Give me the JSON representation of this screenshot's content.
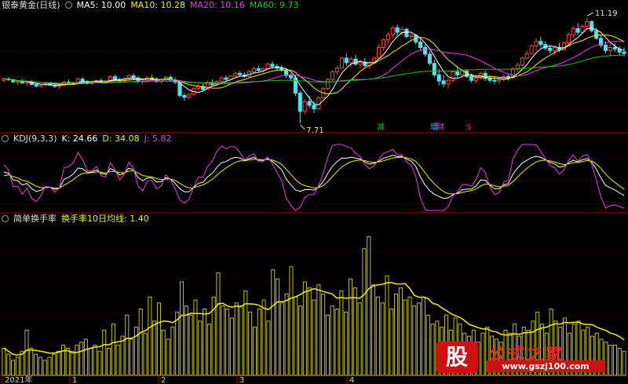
{
  "colors": {
    "up": "#ff4040",
    "down": "#50e0f0",
    "ma5": "#ffffff",
    "ma10": "#f0f000",
    "ma20": "#e040e0",
    "ma60": "#20c020",
    "k": "#ffffff",
    "d": "#f0f000",
    "j": "#e040e0",
    "bar": "#f0f000",
    "avg": "#f0f000",
    "divider": "#a00000"
  },
  "main": {
    "title": "银泰黄金(日线)",
    "ma": [
      {
        "label": "MA5: 10.00",
        "color": "#ffffff"
      },
      {
        "label": "MA10: 10.28",
        "color": "#f0f000"
      },
      {
        "label": "MA20: 10.16",
        "color": "#e040e0"
      },
      {
        "label": "MA60: 9.73",
        "color": "#20c020"
      }
    ],
    "high_label": "11.19",
    "low_label": "7.71",
    "markers": [
      {
        "text": "减",
        "color": "#20c020"
      },
      {
        "text": "增",
        "color": "#20c0ff"
      },
      {
        "text": "财",
        "color": "#e040e0"
      },
      {
        "text": "S",
        "color": "#ff3030"
      }
    ]
  },
  "kdj": {
    "title": "KDJ(9,3,3)",
    "k_label": "K: 24.66",
    "d_label": "D: 34.08",
    "j_label": "J: 5.82"
  },
  "turnover": {
    "title": "简单换手率",
    "avg_label": "换手率10日均线: 1.40"
  },
  "xaxis": {
    "ticks": [
      "2021年",
      "1",
      "2",
      "3",
      "4"
    ]
  },
  "watermark": {
    "box_text": "股",
    "title": "公式之家",
    "url": "www.gszj100.com"
  },
  "chart_data": [
    {
      "type": "candlestick",
      "title": "银泰黄金(日线)",
      "high": 11.19,
      "low": 7.71,
      "ylim": [
        7.5,
        11.4
      ],
      "candles": [
        [
          9.12,
          9.2,
          9.05,
          9.17
        ],
        [
          9.17,
          9.22,
          9.1,
          9.14
        ],
        [
          9.14,
          9.18,
          9.03,
          9.07
        ],
        [
          9.07,
          9.12,
          8.98,
          9.08
        ],
        [
          9.08,
          9.15,
          9.02,
          9.03
        ],
        [
          9.03,
          9.1,
          8.95,
          9.07
        ],
        [
          9.07,
          9.12,
          8.96,
          8.98
        ],
        [
          8.98,
          9.02,
          8.88,
          8.93
        ],
        [
          8.93,
          9.0,
          8.86,
          8.97
        ],
        [
          8.97,
          9.05,
          8.92,
          9.02
        ],
        [
          9.02,
          9.08,
          8.95,
          8.96
        ],
        [
          8.96,
          9.0,
          8.87,
          8.92
        ],
        [
          8.92,
          8.99,
          8.84,
          8.95
        ],
        [
          8.95,
          9.1,
          8.93,
          9.06
        ],
        [
          9.06,
          9.15,
          9.0,
          9.02
        ],
        [
          9.02,
          9.08,
          8.97,
          9.05
        ],
        [
          9.05,
          9.2,
          9.03,
          9.16
        ],
        [
          9.16,
          9.22,
          9.05,
          9.08
        ],
        [
          9.08,
          9.12,
          8.98,
          9.02
        ],
        [
          9.02,
          9.1,
          8.97,
          9.07
        ],
        [
          9.07,
          9.15,
          9.02,
          9.11
        ],
        [
          9.11,
          9.18,
          9.04,
          9.06
        ],
        [
          9.06,
          9.14,
          9.0,
          9.1
        ],
        [
          9.1,
          9.28,
          9.08,
          9.24
        ],
        [
          9.24,
          9.3,
          9.12,
          9.15
        ],
        [
          9.15,
          9.2,
          9.05,
          9.1
        ],
        [
          9.1,
          9.22,
          9.08,
          9.18
        ],
        [
          9.18,
          9.32,
          9.14,
          9.27
        ],
        [
          9.27,
          9.35,
          9.15,
          9.2
        ],
        [
          9.2,
          9.25,
          9.02,
          9.08
        ],
        [
          9.08,
          9.14,
          8.98,
          9.1
        ],
        [
          9.1,
          9.25,
          9.05,
          9.2
        ],
        [
          9.2,
          9.3,
          9.12,
          9.16
        ],
        [
          9.16,
          9.22,
          9.04,
          9.08
        ],
        [
          9.08,
          9.18,
          9.02,
          9.14
        ],
        [
          9.14,
          9.26,
          9.1,
          9.22
        ],
        [
          9.22,
          9.3,
          9.1,
          9.13
        ],
        [
          9.13,
          9.2,
          9.0,
          9.06
        ],
        [
          9.06,
          9.12,
          8.55,
          8.62
        ],
        [
          8.62,
          8.7,
          8.45,
          8.56
        ],
        [
          8.56,
          8.7,
          8.5,
          8.66
        ],
        [
          8.66,
          8.9,
          8.62,
          8.85
        ],
        [
          8.85,
          9.0,
          8.8,
          8.92
        ],
        [
          8.92,
          9.0,
          8.75,
          8.82
        ],
        [
          8.82,
          9.1,
          8.8,
          9.05
        ],
        [
          9.05,
          9.15,
          8.92,
          8.98
        ],
        [
          8.98,
          9.12,
          8.94,
          9.08
        ],
        [
          9.08,
          9.25,
          9.05,
          9.2
        ],
        [
          9.2,
          9.28,
          9.1,
          9.15
        ],
        [
          9.15,
          9.3,
          9.12,
          9.26
        ],
        [
          9.26,
          9.4,
          9.22,
          9.35
        ],
        [
          9.35,
          9.42,
          9.25,
          9.3
        ],
        [
          9.3,
          9.38,
          9.2,
          9.25
        ],
        [
          9.25,
          9.45,
          9.22,
          9.4
        ],
        [
          9.4,
          9.55,
          9.35,
          9.5
        ],
        [
          9.5,
          9.6,
          9.4,
          9.44
        ],
        [
          9.44,
          9.55,
          9.38,
          9.5
        ],
        [
          9.5,
          9.7,
          9.45,
          9.65
        ],
        [
          9.65,
          9.75,
          9.5,
          9.58
        ],
        [
          9.58,
          9.65,
          9.45,
          9.52
        ],
        [
          9.52,
          9.62,
          9.4,
          9.46
        ],
        [
          9.46,
          9.52,
          9.2,
          9.28
        ],
        [
          9.28,
          9.35,
          9.1,
          9.2
        ],
        [
          9.2,
          9.3,
          8.6,
          8.7
        ],
        [
          8.7,
          8.78,
          7.71,
          8.1
        ],
        [
          8.1,
          8.5,
          8.0,
          8.42
        ],
        [
          8.42,
          8.6,
          8.2,
          8.3
        ],
        [
          8.3,
          8.45,
          8.05,
          8.18
        ],
        [
          8.18,
          8.6,
          8.15,
          8.55
        ],
        [
          8.55,
          8.9,
          8.5,
          8.85
        ],
        [
          8.85,
          9.2,
          8.8,
          9.15
        ],
        [
          9.15,
          9.45,
          9.1,
          9.4
        ],
        [
          9.4,
          9.6,
          9.3,
          9.52
        ],
        [
          9.52,
          9.9,
          9.5,
          9.85
        ],
        [
          9.85,
          10.0,
          9.6,
          9.7
        ],
        [
          9.7,
          9.9,
          9.55,
          9.82
        ],
        [
          9.82,
          9.95,
          9.6,
          9.65
        ],
        [
          9.65,
          9.8,
          9.5,
          9.72
        ],
        [
          9.72,
          9.85,
          9.55,
          9.6
        ],
        [
          9.6,
          9.75,
          9.5,
          9.7
        ],
        [
          9.7,
          9.9,
          9.65,
          9.85
        ],
        [
          9.85,
          10.3,
          9.8,
          10.2
        ],
        [
          10.2,
          10.5,
          10.1,
          10.45
        ],
        [
          10.45,
          10.7,
          10.3,
          10.62
        ],
        [
          10.62,
          10.9,
          10.5,
          10.85
        ],
        [
          10.85,
          10.95,
          10.6,
          10.7
        ],
        [
          10.7,
          10.9,
          10.6,
          10.8
        ],
        [
          10.8,
          10.85,
          10.5,
          10.56
        ],
        [
          10.56,
          10.7,
          10.4,
          10.6
        ],
        [
          10.6,
          10.65,
          10.3,
          10.38
        ],
        [
          10.38,
          10.5,
          10.1,
          10.2
        ],
        [
          10.2,
          10.3,
          9.9,
          9.98
        ],
        [
          9.98,
          10.1,
          9.6,
          9.68
        ],
        [
          9.68,
          9.8,
          9.2,
          9.3
        ],
        [
          9.3,
          9.5,
          8.95,
          9.1
        ],
        [
          9.1,
          9.3,
          8.9,
          9.0
        ],
        [
          9.0,
          9.2,
          8.85,
          9.12
        ],
        [
          9.12,
          9.45,
          9.05,
          9.4
        ],
        [
          9.4,
          9.6,
          9.2,
          9.3
        ],
        [
          9.3,
          9.5,
          9.18,
          9.42
        ],
        [
          9.42,
          9.5,
          9.2,
          9.25
        ],
        [
          9.25,
          9.35,
          9.05,
          9.12
        ],
        [
          9.12,
          9.28,
          9.02,
          9.2
        ],
        [
          9.2,
          9.4,
          9.15,
          9.35
        ],
        [
          9.35,
          9.45,
          9.1,
          9.18
        ],
        [
          9.18,
          9.3,
          9.05,
          9.12
        ],
        [
          9.12,
          9.22,
          9.0,
          9.1
        ],
        [
          9.1,
          9.2,
          9.0,
          9.15
        ],
        [
          9.15,
          9.3,
          9.1,
          9.25
        ],
        [
          9.25,
          9.35,
          9.12,
          9.2
        ],
        [
          9.2,
          9.55,
          9.18,
          9.5
        ],
        [
          9.5,
          9.7,
          9.4,
          9.62
        ],
        [
          9.62,
          9.9,
          9.55,
          9.85
        ],
        [
          9.85,
          10.1,
          9.8,
          10.0
        ],
        [
          10.0,
          10.3,
          9.95,
          10.25
        ],
        [
          10.25,
          10.5,
          10.1,
          10.4
        ],
        [
          10.4,
          10.55,
          10.2,
          10.3
        ],
        [
          10.3,
          10.4,
          10.1,
          10.18
        ],
        [
          10.18,
          10.3,
          10.0,
          10.1
        ],
        [
          10.1,
          10.25,
          9.95,
          10.2
        ],
        [
          10.2,
          10.35,
          10.05,
          10.12
        ],
        [
          10.12,
          10.4,
          10.1,
          10.35
        ],
        [
          10.35,
          10.7,
          10.3,
          10.62
        ],
        [
          10.62,
          10.9,
          10.5,
          10.82
        ],
        [
          10.82,
          11.0,
          10.6,
          10.7
        ],
        [
          10.7,
          10.95,
          10.65,
          10.9
        ],
        [
          10.9,
          11.19,
          10.8,
          11.05
        ],
        [
          11.05,
          11.1,
          10.7,
          10.75
        ],
        [
          10.75,
          10.85,
          10.45,
          10.5
        ],
        [
          10.5,
          10.6,
          10.2,
          10.28
        ],
        [
          10.28,
          10.4,
          10.0,
          10.1
        ],
        [
          10.1,
          10.3,
          9.9,
          10.2
        ],
        [
          10.2,
          10.35,
          10.05,
          10.15
        ],
        [
          10.15,
          10.25,
          9.95,
          10.05
        ],
        [
          10.05,
          10.2,
          9.9,
          10.0
        ]
      ],
      "series": [
        {
          "name": "MA5",
          "values": []
        },
        {
          "name": "MA10",
          "values": []
        },
        {
          "name": "MA20",
          "values": []
        },
        {
          "name": "MA60",
          "values": []
        }
      ]
    },
    {
      "type": "line",
      "title": "KDJ(9,3,3)",
      "ylim": [
        -10,
        110
      ],
      "series": [
        {
          "name": "K",
          "values": []
        },
        {
          "name": "D",
          "values": []
        },
        {
          "name": "J",
          "values": []
        }
      ]
    },
    {
      "type": "bar",
      "title": "简单换手率",
      "values": [
        0.9,
        0.7,
        0.5,
        0.6,
        0.8,
        1.5,
        0.9,
        0.7,
        0.6,
        0.5,
        0.6,
        0.7,
        0.8,
        1.0,
        0.9,
        0.8,
        1.0,
        1.1,
        1.2,
        0.9,
        1.0,
        0.8,
        1.5,
        0.9,
        1.7,
        1.0,
        1.3,
        2.0,
        1.2,
        1.6,
        2.2,
        1.4,
        2.6,
        1.8,
        2.4,
        1.5,
        1.2,
        1.6,
        2.1,
        3.1,
        2.3,
        2.0,
        2.5,
        1.8,
        2.2,
        1.7,
        2.6,
        3.4,
        2.3,
        2.2,
        1.9,
        2.4,
        2.3,
        2.8,
        2.1,
        1.6,
        2.2,
        2.5,
        1.8,
        3.5,
        3.2,
        2.4,
        2.7,
        3.6,
        2.6,
        2.3,
        3.1,
        2.9,
        2.5,
        3.0,
        2.7,
        2.0,
        2.3,
        2.2,
        2.8,
        2.1,
        3.2,
        2.9,
        2.4,
        4.2,
        4.6,
        3.0,
        2.6,
        2.4,
        3.3,
        2.2,
        2.7,
        2.9,
        2.5,
        2.6,
        2.3,
        2.4,
        2.6,
        2.0,
        1.7,
        1.8,
        1.6,
        2.0,
        1.5,
        1.9,
        1.7,
        1.4,
        1.3,
        1.5,
        1.1,
        1.4,
        1.6,
        1.3,
        1.2,
        1.1,
        1.5,
        1.4,
        1.7,
        1.3,
        1.6,
        1.5,
        1.8,
        2.1,
        1.7,
        1.4,
        2.2,
        1.8,
        1.6,
        1.9,
        1.4,
        1.7,
        1.8,
        1.5,
        1.6,
        1.3,
        1.4,
        1.2,
        1.1,
        1.0,
        1.0,
        0.9,
        0.8
      ],
      "series": [
        {
          "name": "换手率10日均线",
          "values": []
        }
      ],
      "ylim": [
        0,
        5
      ]
    }
  ]
}
